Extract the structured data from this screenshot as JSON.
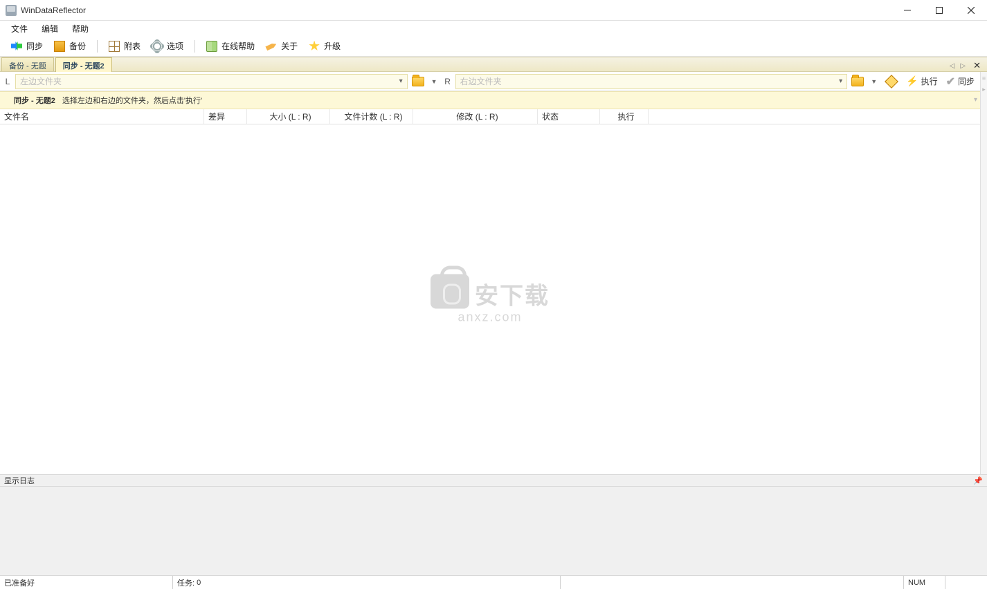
{
  "title": "WinDataReflector",
  "menu": {
    "file": "文件",
    "edit": "编辑",
    "help": "帮助"
  },
  "toolbar": {
    "sync": "同步",
    "backup": "备份",
    "table": "附表",
    "options": "选项",
    "online_help": "在线帮助",
    "about": "关于",
    "upgrade": "升级"
  },
  "tabs": {
    "t1": "备份 - 无题",
    "t2": "同步 - 无题2"
  },
  "path": {
    "L": "L",
    "left_placeholder": "左边文件夹",
    "R": "R",
    "right_placeholder": "右边文件夹",
    "run": "执行",
    "sync": "同步"
  },
  "hint": {
    "name": "同步 - 无题2",
    "text": "选择左边和右边的文件夹，然后点击'执行'"
  },
  "cols": {
    "filename": "文件名",
    "diff": "差异",
    "size": "大小 (L : R)",
    "count": "文件计数 (L : R)",
    "modify": "修改 (L : R)",
    "status": "状态",
    "run": "执行"
  },
  "watermark": {
    "big": "安下载",
    "small": "anxz.com"
  },
  "log": {
    "title": "显示日志"
  },
  "status": {
    "ready": "已准备好",
    "tasks_label": "任务:",
    "tasks_count": "0",
    "num": "NUM"
  }
}
